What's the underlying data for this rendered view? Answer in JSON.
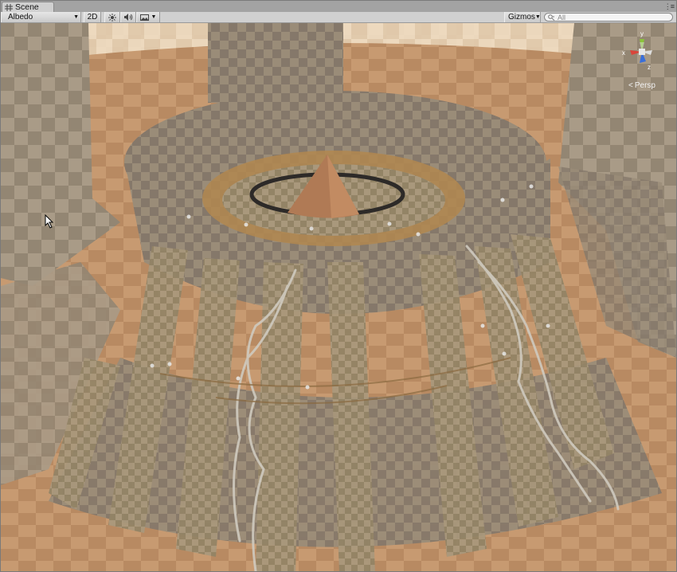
{
  "window": {
    "tab_title": "Scene",
    "tab_icon": "hash-grid-icon",
    "menu_icon": "window-menu-icon"
  },
  "toolbar": {
    "shading_mode": "Albedo",
    "mode_2d": "2D",
    "lighting_icon": "sun-icon",
    "audio_icon": "speaker-icon",
    "effects_icon": "image-icon",
    "gizmos_label": "Gizmos",
    "search_placeholder": "All"
  },
  "gizmo": {
    "projection_label": "Persp",
    "axis_x": "x",
    "axis_y": "y",
    "axis_z": "z"
  },
  "colors": {
    "sky": "#efdcc0",
    "ground": "#c49a72",
    "tower": "#988a76",
    "checker_dark": "#7f725f",
    "axis_x": "#d9453b",
    "axis_y": "#8bc43a",
    "axis_z": "#3a6fd9"
  }
}
